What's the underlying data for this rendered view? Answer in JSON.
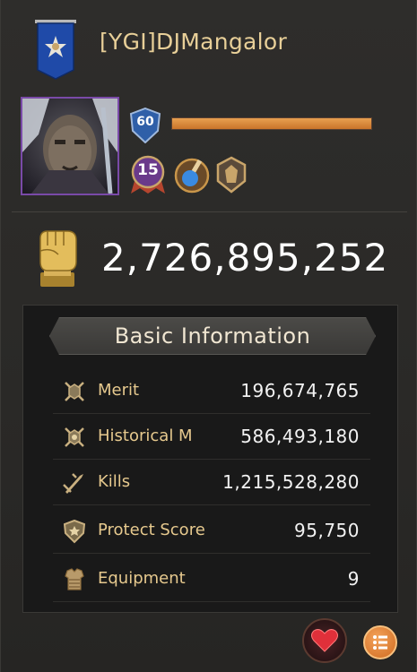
{
  "player": {
    "name": "[YGI]DJMangalor",
    "level": "60",
    "xp_fraction": 1.0,
    "rank_medal": "15"
  },
  "power": {
    "value": "2,726,895,252",
    "icon": "fist-icon"
  },
  "basic_info": {
    "title": "Basic Information",
    "rows": [
      {
        "label": "Merit",
        "value": "196,674,765",
        "icon": "merit-icon"
      },
      {
        "label": "Historical M",
        "value": "586,493,180",
        "icon": "historical-merit-icon"
      },
      {
        "label": "Kills",
        "value": "1,215,528,280",
        "icon": "crossed-swords-icon"
      },
      {
        "label": "Protect Score",
        "value": "95,750",
        "icon": "shield-icon"
      },
      {
        "label": "Equipment",
        "value": "9",
        "icon": "armor-icon"
      }
    ]
  },
  "buttons": {
    "like": "heart-icon",
    "menu": "list-icon"
  },
  "colors": {
    "name": "#e8cf98",
    "label": "#e6c98e",
    "xp": "#d9883c",
    "avatar_border": "#7a4aa8"
  }
}
